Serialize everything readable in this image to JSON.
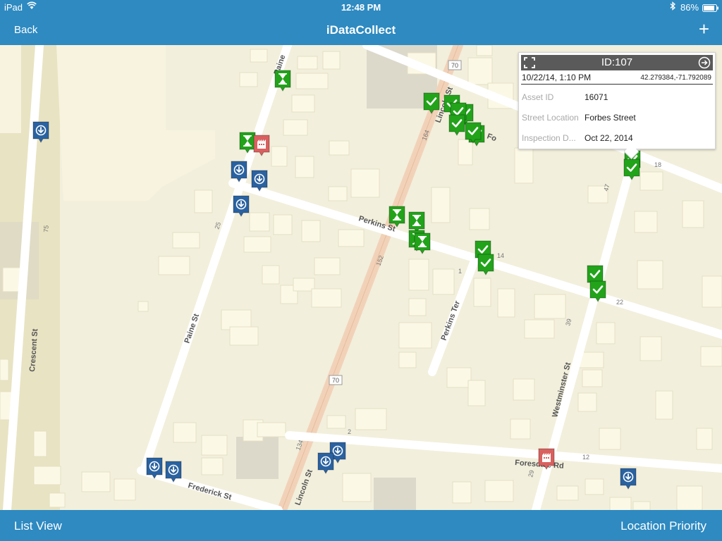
{
  "status_bar": {
    "device": "iPad",
    "time": "12:48 PM",
    "battery": "86%"
  },
  "nav": {
    "back_label": "Back",
    "title": "iDataCollect",
    "add_symbol": "+"
  },
  "toolbar": {
    "left_label": "List View",
    "right_label": "Location Priority"
  },
  "popup": {
    "title": "ID:107",
    "datetime": "10/22/14, 1:10 PM",
    "coords": "42.279384,-71.792089",
    "fields": [
      {
        "label": "Asset ID",
        "value": "16071"
      },
      {
        "label": "Street Location",
        "value": "Forbes Street"
      },
      {
        "label": "Inspection D...",
        "value": "Oct 22, 2014"
      }
    ]
  },
  "map": {
    "street_labels": [
      "Crescent St",
      "Paine St",
      "Paine",
      "Perkins St",
      "Perkins Ter",
      "Lincoln St",
      "Frederick St",
      "Foresdale Rd",
      "Westminster St",
      "Fo"
    ],
    "route_shields": [
      "70",
      "70"
    ],
    "house_numbers": [
      "75",
      "25",
      "152",
      "134",
      "164",
      "14",
      "1",
      "18",
      "47",
      "22",
      "39",
      "29",
      "2",
      "12"
    ]
  },
  "marker_types": {
    "completed": {
      "color": "#22a31a",
      "icon": "check-icon"
    },
    "pending": {
      "color": "#22a31a",
      "icon": "hourglass-icon"
    },
    "download": {
      "color": "#2a62a1",
      "icon": "download-icon"
    },
    "issue": {
      "color": "#d9605f",
      "icon": "building-icon"
    }
  }
}
